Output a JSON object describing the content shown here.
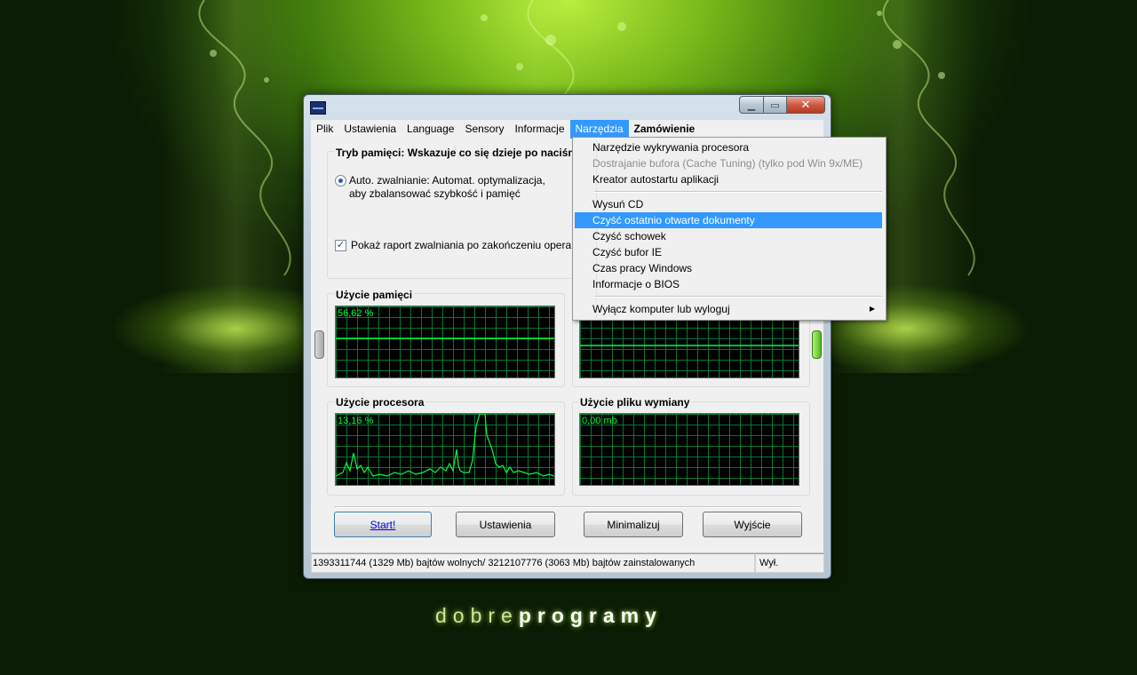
{
  "window": {
    "app_icon": "app-monitor-icon",
    "minimize_glyph": "▁",
    "maximize_glyph": "▭",
    "close_glyph": "✕"
  },
  "menubar": {
    "items": [
      "Plik",
      "Ustawienia",
      "Language",
      "Sensory",
      "Informacje",
      "Narzędzia",
      "Zamówienie"
    ],
    "active": "Narzędzia"
  },
  "memory_mode": {
    "title": "Tryb pamięci: Wskazuje co się dzieje po naciśni",
    "radio_line1": "Auto. zwalnianie: Automat. optymalizacja,",
    "radio_line2": "aby zbalansować szybkość i pamięć",
    "checkbox_label": "Pokaż raport zwalniania po zakończeniu opera",
    "checkbox_checked": true
  },
  "graphs": {
    "memory": {
      "title": "Użycie pamięci",
      "value": "56,62 %"
    },
    "cpu": {
      "title": "Użycie procesora",
      "value": "13,16 %"
    },
    "swap": {
      "title": "Użycie pliku wymiany",
      "value": "0,00 mb"
    }
  },
  "buttons": {
    "start": "Start!",
    "settings": "Ustawienia",
    "minimize": "Minimalizuj",
    "exit": "Wyjście"
  },
  "statusbar": {
    "memory_info": "1393311744 (1329 Mb) bajtów wolnych/ 3212107776 (3063 Mb) bajtów zainstalowanych",
    "state": "Wył."
  },
  "dropdown": {
    "items": [
      {
        "label": "Narzędzie wykrywania procesora",
        "disabled": false
      },
      {
        "label": "Dostrajanie bufora (Cache Tuning) (tylko pod Win 9x/ME)",
        "disabled": true
      },
      {
        "label": "Kreator autostartu aplikacji",
        "disabled": false
      },
      {
        "label": "Wysuń CD",
        "disabled": false
      },
      {
        "label": "Czyść ostatnio otwarte dokumenty",
        "disabled": false,
        "highlighted": true
      },
      {
        "label": "Czyść schowek",
        "disabled": false
      },
      {
        "label": "Czyść bufor IE",
        "disabled": false
      },
      {
        "label": "Czas pracy Windows",
        "disabled": false
      },
      {
        "label": "Informacje o BIOS",
        "disabled": false
      },
      {
        "label": "Wyłącz komputer lub wyloguj",
        "disabled": false,
        "submenu": true
      }
    ],
    "submenu_glyph": "▶"
  },
  "logo": {
    "part1": "dobre",
    "part2": "programy"
  },
  "colors": {
    "highlight": "#3399ff",
    "graph_line": "#00ff3a",
    "graph_grid": "#008c41"
  }
}
